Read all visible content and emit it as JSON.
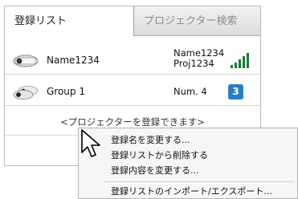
{
  "tabs": {
    "active_label": "登録リスト",
    "inactive_label": "プロジェクター検索"
  },
  "rows": [
    {
      "name": "Name1234",
      "detail_line1": "Name1234",
      "detail_line2": "Proj1234",
      "icon": "projector-icon",
      "status_icon": "signal-strength-icon"
    },
    {
      "name": "Group 1",
      "detail": "Num. 4",
      "icon": "projector-group-icon",
      "count": "3"
    }
  ],
  "placeholder": "<プロジェクターを登録できます>",
  "placeholder_partial": "<プ",
  "context_menu": {
    "items": [
      "登録名を変更する...",
      "登録リストから削除する",
      "登録内容を変更する...",
      "登録リストのインポート/エクスポート..."
    ]
  },
  "colors": {
    "badge": "#2a7ec3",
    "signal": "#1a7a3a",
    "tab_inactive_text": "#8c8c8c"
  }
}
